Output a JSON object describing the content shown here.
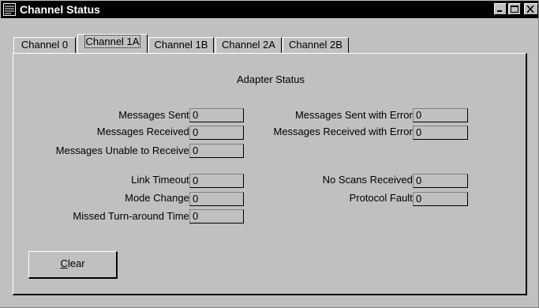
{
  "window": {
    "title": "Channel Status"
  },
  "tabs": [
    {
      "label": "Channel 0",
      "active": false
    },
    {
      "label": "Channel 1A",
      "active": true
    },
    {
      "label": "Channel 1B",
      "active": false
    },
    {
      "label": "Channel 2A",
      "active": false
    },
    {
      "label": "Channel 2B",
      "active": false
    }
  ],
  "adapter_status": {
    "title": "Adapter Status",
    "messages_sent": {
      "label": "Messages Sent =",
      "value": "0"
    },
    "messages_received": {
      "label": "Messages Received =",
      "value": "0"
    },
    "messages_unable": {
      "label": "Messages Unable to Receive =",
      "value": "0"
    },
    "messages_sent_error": {
      "label": "Messages Sent with Error =",
      "value": "0"
    },
    "messages_received_error": {
      "label": "Messages Received with Error =",
      "value": "0"
    },
    "link_timeout": {
      "label": "Link Timeout =",
      "value": "0"
    },
    "mode_change": {
      "label": "Mode Change =",
      "value": "0"
    },
    "missed_turnaround": {
      "label": "Missed Turn-around Time =",
      "value": "0"
    },
    "no_scans": {
      "label": "No Scans Received =",
      "value": "0"
    },
    "protocol_fault": {
      "label": "Protocol Fault =",
      "value": "0"
    }
  },
  "clear_button": {
    "mnemonic": "C",
    "rest": "lear"
  }
}
